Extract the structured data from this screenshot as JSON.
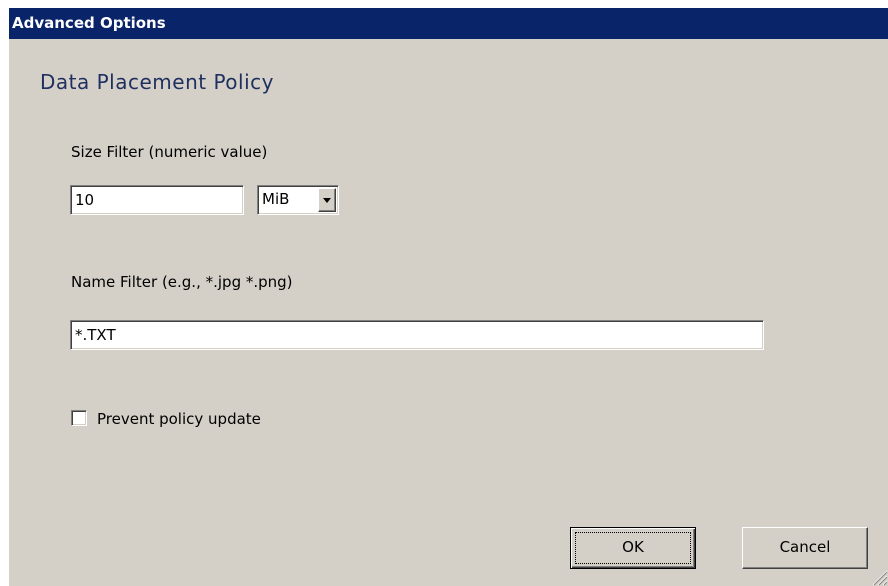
{
  "window": {
    "title": "Advanced Options"
  },
  "section": {
    "title": "Data Placement Policy"
  },
  "size_filter": {
    "label": "Size Filter (numeric value)",
    "value": "10",
    "unit": "MiB"
  },
  "name_filter": {
    "label": "Name Filter (e.g., *.jpg *.png)",
    "value": "*.TXT"
  },
  "prevent_update": {
    "label": "Prevent policy update",
    "checked": false
  },
  "buttons": {
    "ok_label": "OK",
    "cancel_label": "Cancel"
  },
  "colors": {
    "titlebar": "#0a246a",
    "dialog_bg": "#d4d0c8",
    "section_title": "#1f2f5f"
  }
}
